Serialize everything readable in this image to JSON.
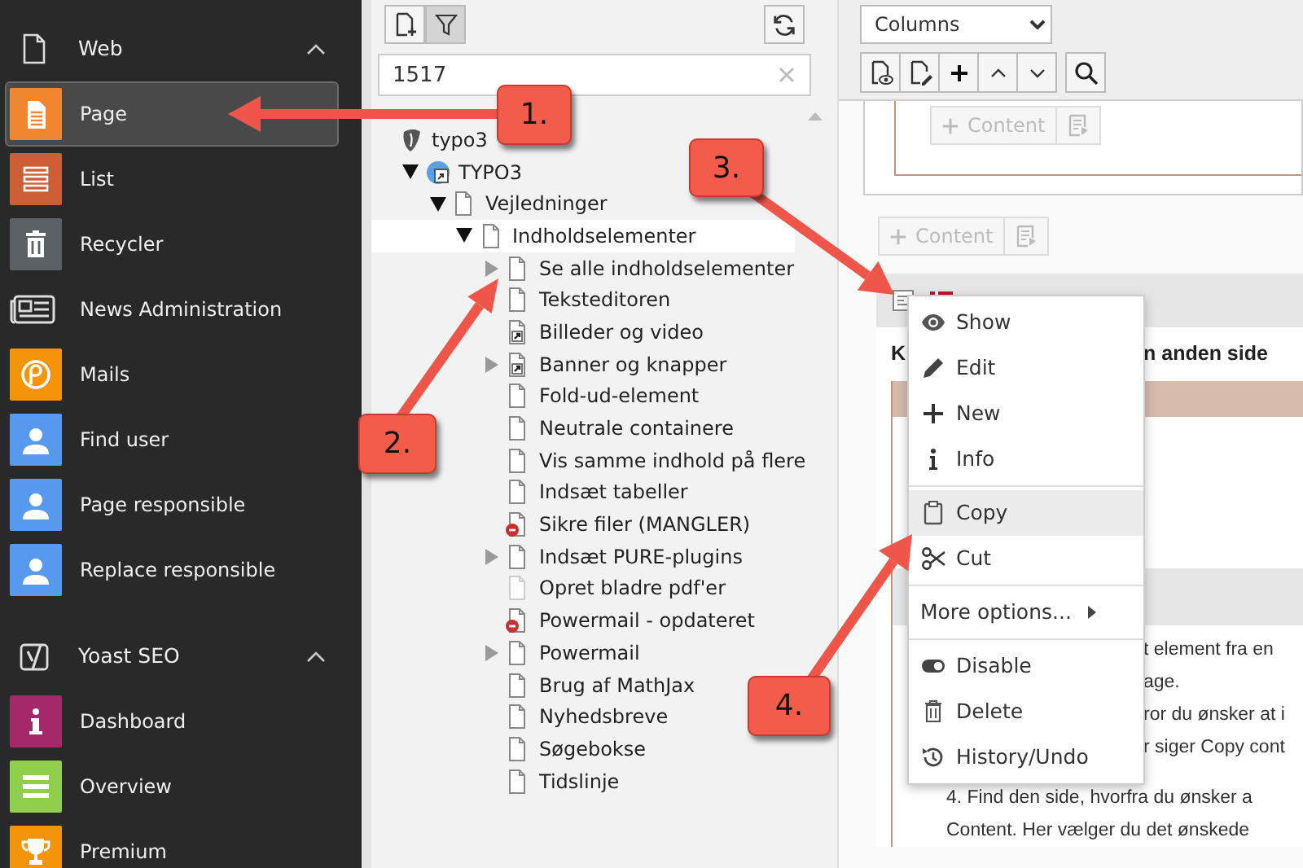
{
  "sidebar": {
    "groups": [
      {
        "title": "Web",
        "expanded": true,
        "items": [
          {
            "label": "Page",
            "selected": true,
            "color": "#f0862f"
          },
          {
            "label": "List",
            "selected": false,
            "color": "#cc5f35"
          },
          {
            "label": "Recycler",
            "selected": false,
            "color": "#5b6265"
          },
          {
            "label": "News Administration",
            "selected": false
          },
          {
            "label": "Mails",
            "selected": false,
            "color": "#f39409"
          },
          {
            "label": "Find user",
            "selected": false,
            "color": "#5699ee"
          },
          {
            "label": "Page responsible",
            "selected": false,
            "color": "#5699ee"
          },
          {
            "label": "Replace responsible",
            "selected": false,
            "color": "#5699ee"
          }
        ]
      },
      {
        "title": "Yoast SEO",
        "expanded": true,
        "items": [
          {
            "label": "Dashboard",
            "selected": false,
            "color": "#a4286a"
          },
          {
            "label": "Overview",
            "selected": false,
            "color": "#8fcf4b"
          },
          {
            "label": "Premium",
            "selected": false,
            "color": "#f39409"
          }
        ]
      }
    ]
  },
  "page_tree": {
    "filter": "1517",
    "nodes": [
      {
        "label": "typo3",
        "kind": "root",
        "selected": false,
        "children": [
          {
            "label": "TYPO3",
            "kind": "site",
            "expanded": true,
            "selected": false,
            "children": [
              {
                "label": "Vejledninger",
                "kind": "page",
                "expanded": true,
                "selected": false,
                "children": [
                  {
                    "label": "Indholdselementer",
                    "kind": "page",
                    "expanded": true,
                    "selected": true,
                    "children": [
                      {
                        "label": "Se alle indholdselementer",
                        "kind": "page",
                        "expanded": false,
                        "selected": false
                      },
                      {
                        "label": "Teksteditoren",
                        "kind": "page",
                        "selected": false
                      },
                      {
                        "label": "Billeder og video",
                        "kind": "shortcut",
                        "selected": false
                      },
                      {
                        "label": "Banner og knapper",
                        "kind": "shortcut",
                        "expanded": false,
                        "selected": false
                      },
                      {
                        "label": "Fold-ud-element",
                        "kind": "page",
                        "selected": false
                      },
                      {
                        "label": "Neutrale containere",
                        "kind": "page",
                        "selected": false
                      },
                      {
                        "label": "Vis samme indhold på flere",
                        "kind": "page",
                        "selected": false
                      },
                      {
                        "label": "Indsæt tabeller",
                        "kind": "page",
                        "selected": false
                      },
                      {
                        "label": "Sikre filer (MANGLER)",
                        "kind": "restricted",
                        "selected": false
                      },
                      {
                        "label": "Indsæt PURE-plugins",
                        "kind": "page",
                        "expanded": false,
                        "selected": false
                      },
                      {
                        "label": "Opret bladre pdf'er",
                        "kind": "faded",
                        "selected": false
                      },
                      {
                        "label": "Powermail - opdateret",
                        "kind": "restricted",
                        "selected": false
                      },
                      {
                        "label": "Powermail",
                        "kind": "page",
                        "expanded": false,
                        "selected": false
                      },
                      {
                        "label": "Brug af MathJax",
                        "kind": "page",
                        "selected": false
                      },
                      {
                        "label": "Nyhedsbreve",
                        "kind": "page",
                        "selected": false
                      },
                      {
                        "label": "Søgebokse",
                        "kind": "page",
                        "selected": false
                      },
                      {
                        "label": "Tidslinje",
                        "kind": "page",
                        "selected": false
                      }
                    ]
                  }
                ]
              }
            ]
          }
        ]
      }
    ]
  },
  "page_module": {
    "view_select": "Columns",
    "add_content_buttons": [
      "Content",
      "Content"
    ],
    "element": {
      "heading_start": "K",
      "heading_end": "n anden side",
      "partial_lines": [
        "t element fra en",
        "age.",
        "ror du ønsker at i",
        "r siger Copy cont"
      ],
      "lines": [
        "4. Find den side, hvorfra du ønsker a",
        "Content. Her vælger du det ønskede"
      ]
    }
  },
  "context_menu": {
    "sections": [
      [
        {
          "label": "Show",
          "hovered": false,
          "submenu": false
        },
        {
          "label": "Edit",
          "hovered": false,
          "submenu": false
        },
        {
          "label": "New",
          "hovered": false,
          "submenu": false
        },
        {
          "label": "Info",
          "hovered": false,
          "submenu": false
        }
      ],
      [
        {
          "label": "Copy",
          "hovered": true,
          "submenu": false
        },
        {
          "label": "Cut",
          "hovered": false,
          "submenu": false
        }
      ],
      [
        {
          "label": "More options...",
          "hovered": false,
          "submenu": true
        }
      ],
      [
        {
          "label": "Disable",
          "hovered": false,
          "submenu": false
        },
        {
          "label": "Delete",
          "hovered": false,
          "submenu": false
        },
        {
          "label": "History/Undo",
          "hovered": false,
          "submenu": false
        }
      ]
    ]
  },
  "callouts": [
    "1.",
    "2.",
    "3.",
    "4."
  ]
}
